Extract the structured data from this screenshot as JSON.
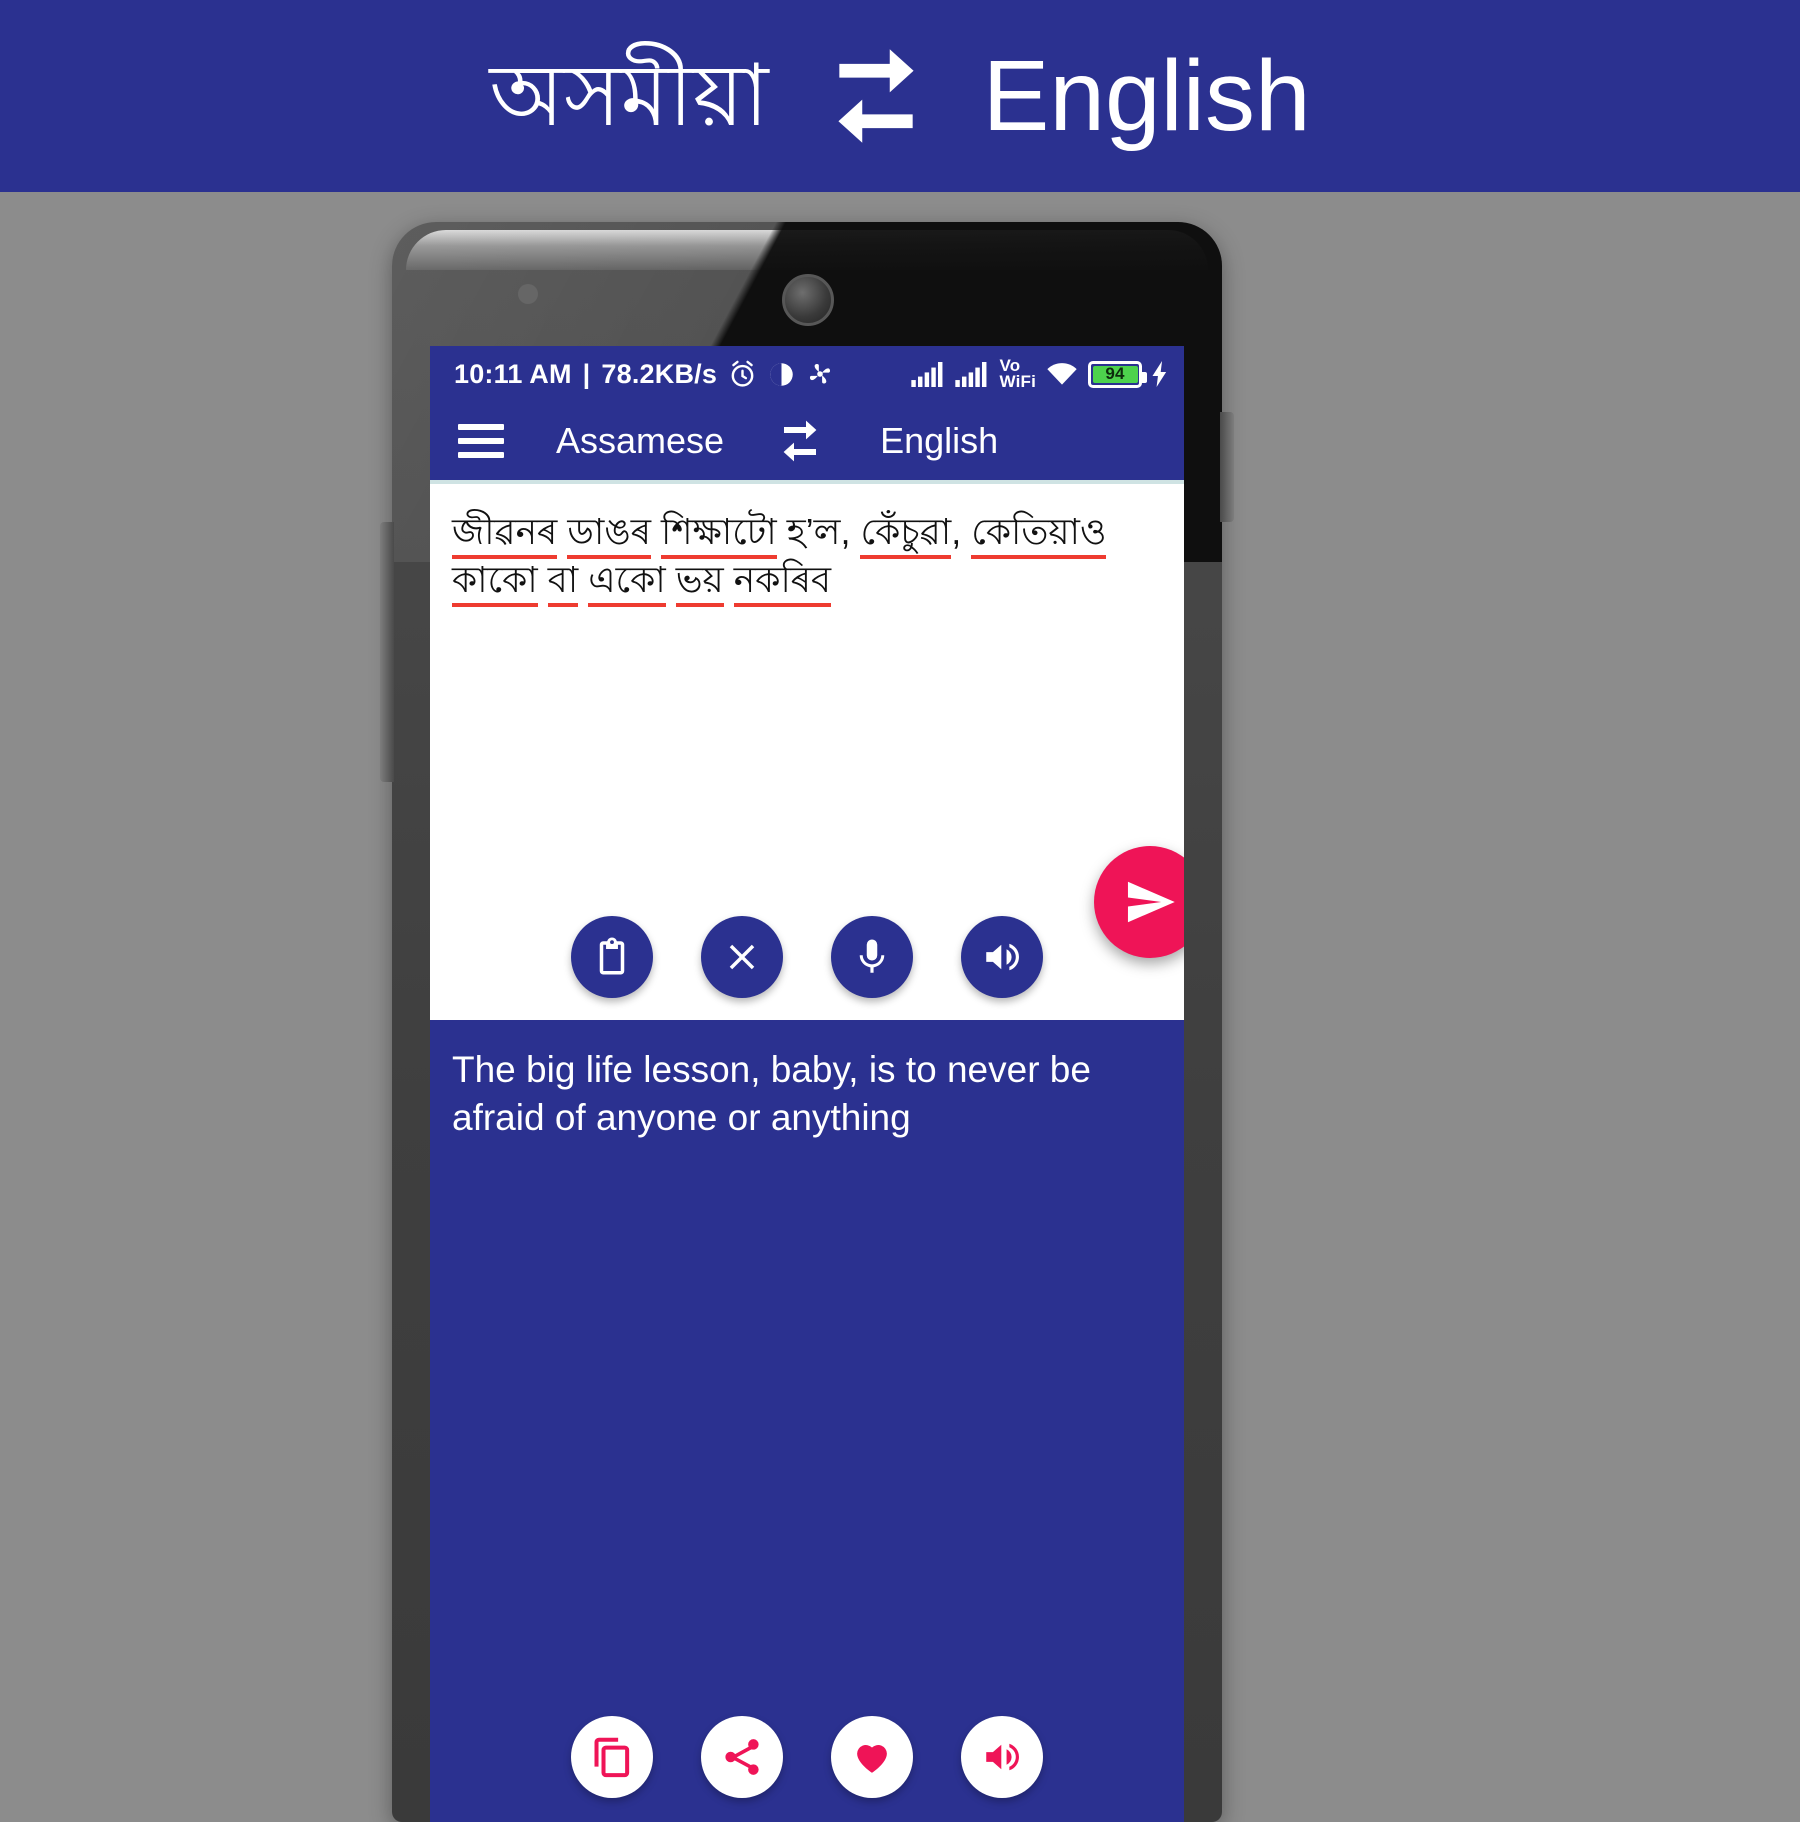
{
  "banner": {
    "source_language": "অসমীয়া",
    "swap_icon": "swap-horizontal-icon",
    "target_language": "English",
    "background_color": "#2b3190",
    "text_color": "#ffffff"
  },
  "phone": {
    "status_bar": {
      "time": "10:11 AM",
      "separator": "|",
      "network_speed": "78.2KB/s",
      "icons_left": [
        "alarm-icon",
        "do-not-disturb-icon",
        "data-saver-icon"
      ],
      "signal_1": "signal-bars-icon",
      "signal_2": "signal-bars-icon",
      "vowifi_line1": "Vo",
      "vowifi_line2": "WiFi",
      "wifi": "wifi-icon",
      "battery_percent": "94",
      "charging": "charging-bolt-icon",
      "background_color": "#2b3190"
    },
    "app_bar": {
      "menu_icon": "hamburger-menu-icon",
      "source_language": "Assamese",
      "swap_icon": "swap-horizontal-icon",
      "target_language": "English",
      "background_color": "#2b3190"
    },
    "source_panel": {
      "text_line_1_prefix": "",
      "segments": [
        {
          "text": "জীৱনৰ",
          "spellcheck": true
        },
        {
          "text": " ",
          "spellcheck": false
        },
        {
          "text": "ডাঙৰ",
          "spellcheck": true
        },
        {
          "text": " ",
          "spellcheck": false
        },
        {
          "text": "শিক্ষাটো",
          "spellcheck": true
        },
        {
          "text": " হ’ল, ",
          "spellcheck": false
        },
        {
          "text": "কেঁচুৱা",
          "spellcheck": true
        },
        {
          "text": ", ",
          "spellcheck": false
        },
        {
          "text": "কেতিয়াও",
          "spellcheck": true
        },
        {
          "text": " ",
          "spellcheck": false
        },
        {
          "text": "কাকো",
          "spellcheck": true
        },
        {
          "text": " ",
          "spellcheck": false
        },
        {
          "text": "বা",
          "spellcheck": true
        },
        {
          "text": " ",
          "spellcheck": false
        },
        {
          "text": "একো",
          "spellcheck": true
        },
        {
          "text": " ",
          "spellcheck": false
        },
        {
          "text": "ভয়",
          "spellcheck": true
        },
        {
          "text": " ",
          "spellcheck": false
        },
        {
          "text": "নকৰিব",
          "spellcheck": true
        }
      ],
      "full_text": "জীৱনৰ ডাঙৰ শিক্ষাটো হ’ল, কেঁচুৱা, কেতিয়াও কাকো বা একো ভয় নকৰিব",
      "spellcheck_underline_color": "#ee3b30",
      "buttons": [
        {
          "name": "paste-button",
          "icon": "clipboard-icon"
        },
        {
          "name": "clear-button",
          "icon": "close-x-icon"
        },
        {
          "name": "voice-input-button",
          "icon": "microphone-icon"
        },
        {
          "name": "speak-source-button",
          "icon": "speaker-volume-icon"
        }
      ]
    },
    "send_button": {
      "icon": "send-paper-plane-icon",
      "color": "#ef1457"
    },
    "target_panel": {
      "text": "The big life lesson, baby, is to never be afraid of anyone or anything",
      "background_color": "#2b3190",
      "text_color": "#ffffff",
      "buttons": [
        {
          "name": "copy-button",
          "icon": "copy-icon"
        },
        {
          "name": "share-button",
          "icon": "share-icon"
        },
        {
          "name": "favorite-button",
          "icon": "heart-icon"
        },
        {
          "name": "speak-target-button",
          "icon": "speaker-volume-icon"
        }
      ],
      "icon_color": "#ef1457"
    }
  }
}
